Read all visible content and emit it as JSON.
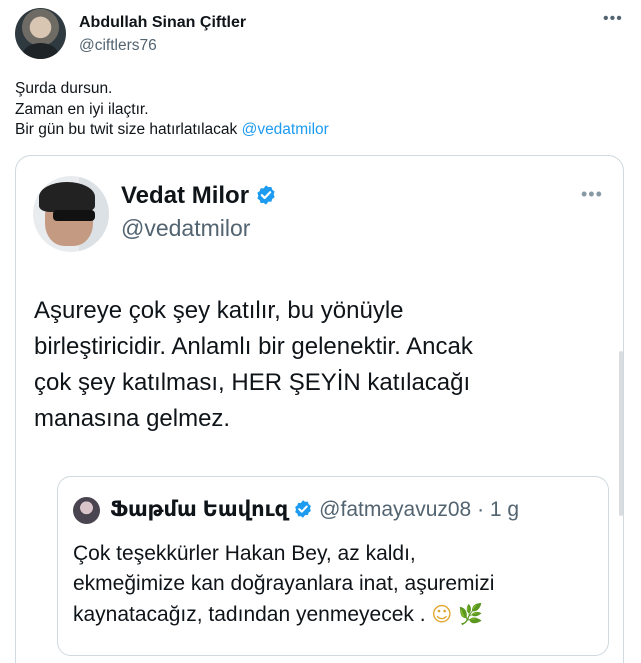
{
  "outer_tweet": {
    "author_name": "Abdullah Sinan Çiftler",
    "handle": "@ciftlers76",
    "more": "•••",
    "text_lines": [
      "Şurda dursun.",
      "Zaman en iyi ilaçtır.",
      "Bir gün bu twit size hatırlatılacak "
    ],
    "mention": "@vedatmilor"
  },
  "quoted_tweet": {
    "author_name": "Vedat Milor",
    "handle": "@vedatmilor",
    "verified_icon": "verified-badge",
    "more": "•••",
    "text_lines": [
      "Aşureye çok şey katılır, bu yönüyle",
      "birleştiricidir. Anlamlı bir gelenektir. Ancak",
      "çok şey katılması, HER ŞEYİN katılacağı",
      "manasına gelmez."
    ]
  },
  "nested_quote": {
    "author_name": "Ֆաթմա Եավուզ",
    "handle": "@fatmayavuz08",
    "separator": " · ",
    "time": "1 g",
    "text_lines": [
      "Çok teşekkürler Hakan Bey, az kaldı,",
      "ekmeğimize kan doğrayanlara inat, aşuremizi",
      "kaynatacağız, tadından yenmeyecek . "
    ],
    "emoji_1": "☺",
    "emoji_2": "🌿"
  },
  "colors": {
    "accent": "#1d9bf0",
    "text": "#0f1419",
    "secondary": "#536471",
    "border": "#cfd9de"
  }
}
